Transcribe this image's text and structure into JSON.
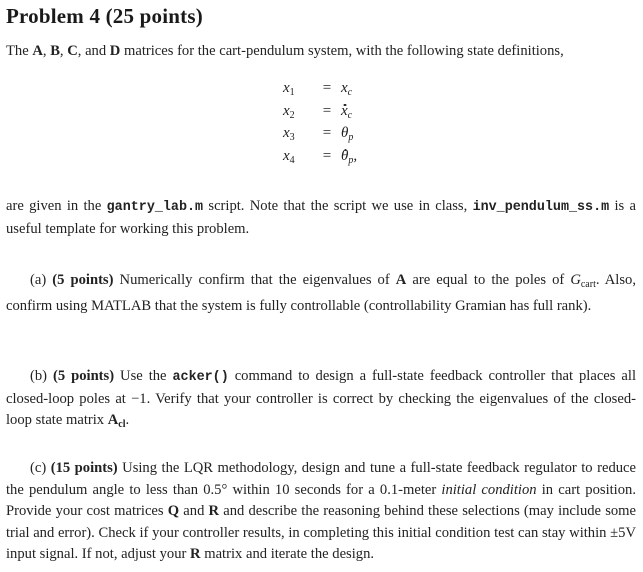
{
  "header": {
    "title": "Problem 4 (25 points)"
  },
  "intro": {
    "t1": "The ",
    "A": "A",
    "sep1": ", ",
    "B": "B",
    "sep2": ", ",
    "C": "C",
    "t2": ", and ",
    "D": "D",
    "t3": " matrices for the cart-pendulum system, with the following state definitions,"
  },
  "state_definitions": [
    {
      "lhs_var": "x",
      "lhs_sub": "1",
      "op": "=",
      "rhs_var": "x",
      "rhs_sub": "c",
      "rhs_dot": false,
      "suffix": ""
    },
    {
      "lhs_var": "x",
      "lhs_sub": "2",
      "op": "=",
      "rhs_var": "x",
      "rhs_sub": "c",
      "rhs_dot": true,
      "suffix": ""
    },
    {
      "lhs_var": "x",
      "lhs_sub": "3",
      "op": "=",
      "rhs_var": "θ",
      "rhs_sub": "p",
      "rhs_dot": false,
      "suffix": ""
    },
    {
      "lhs_var": "x",
      "lhs_sub": "4",
      "op": "=",
      "rhs_var": "θ",
      "rhs_sub": "p",
      "rhs_dot": true,
      "suffix": ","
    }
  ],
  "scripts_para": {
    "t1": "are given in the ",
    "script1": "gantry_lab.m",
    "t2": " script.  Note that the script we use in class, ",
    "script2": "inv_pendulum_ss.m",
    "t3": " is a useful template for working this problem."
  },
  "part_a": {
    "label": "(a) ",
    "points": "(5 points)",
    "t1": " Numerically confirm that the eigenvalues of ",
    "A": "A",
    "t2": " are equal to the poles of ",
    "G": "G",
    "G_sub": "cart",
    "t3": ". Also, confirm using MATLAB that the system is fully controllable (controllability Gramian has full rank)."
  },
  "part_b": {
    "label": "(b) ",
    "points": "(5 points)",
    "t1": " Use the ",
    "cmd": "acker()",
    "t2": " command to design a full-state feedback controller that places all closed-loop poles at −1.  Verify that your controller is correct by checking the eigenvalues of the closed-loop state matrix ",
    "Acl": "A",
    "Acl_sub": "cl",
    "t3": "."
  },
  "part_c": {
    "label": "(c) ",
    "points": "(15 points)",
    "t1": " Using the LQR methodology, design and tune a full-state feedback regulator to reduce the pendulum angle to less than 0.5° within 10 seconds for a 0.1-meter ",
    "italic": "initial condition",
    "t2": " in cart position.  Provide your cost matrices ",
    "Q": "Q",
    "t3": " and ",
    "R": "R",
    "t4": " and describe the reasoning behind these selections (may include some trial and error).  Check if your controller results, in completing this initial condition test can stay within ±5V input signal.  If not, adjust your ",
    "R2": "R",
    "t5": " matrix and iterate the design."
  }
}
